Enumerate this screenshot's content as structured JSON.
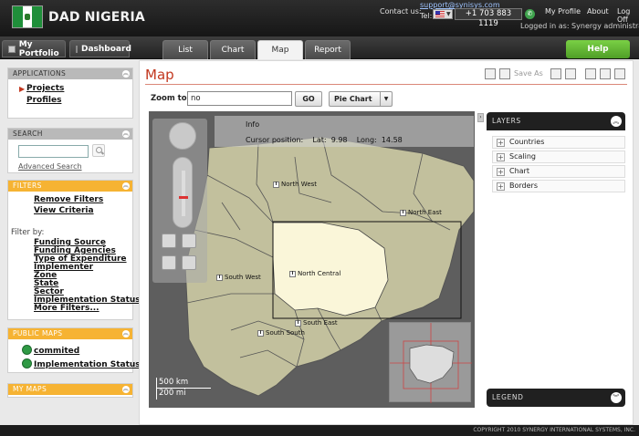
{
  "header": {
    "brand": "DAD NIGERIA",
    "contact_label": "Contact us:",
    "contact_email": "support@synisys.com",
    "tel_label": "Tel:",
    "tel_number": "+1 703 883 1119",
    "links": [
      "My Profile",
      "About",
      "Log Off"
    ],
    "logged_in": "Logged in as:  Synergy  administrator!"
  },
  "tabbar": {
    "my_portfolio": "My Portfolio",
    "dashboard": "Dashboard",
    "tabs": [
      "List",
      "Chart",
      "Map",
      "Report"
    ],
    "active_tab": "Map",
    "help": "Help"
  },
  "sidebar": {
    "applications": {
      "title": "APPLICATIONS",
      "items": [
        "Projects",
        "Profiles"
      ]
    },
    "search": {
      "title": "SEARCH",
      "value": "",
      "advanced": "Advanced Search"
    },
    "filters": {
      "title": "FILTERS",
      "remove": "Remove Filters",
      "view": "View Criteria",
      "filter_by": "Filter by:",
      "items": [
        "Funding Source",
        "Funding Agencies",
        "Type of Expenditure",
        "Implementer",
        "Zone",
        "State",
        "Sector",
        "Implementation Status",
        "More Filters..."
      ]
    },
    "public_maps": {
      "title": "PUBLIC MAPS",
      "items": [
        "commited",
        "Implementation Status"
      ]
    },
    "my_maps": {
      "title": "MY MAPS"
    }
  },
  "main": {
    "title": "Map",
    "save_as": "Save As",
    "zoom_label": "Zoom to:",
    "zoom_value": "no",
    "go": "GO",
    "chart_select": "Pie Chart",
    "info": {
      "title": "Info",
      "cursor_label": "Cursor position:",
      "lat_label": "Lat:",
      "lat": "9.98",
      "long_label": "Long:",
      "long": "14.58"
    },
    "regions": [
      "North West",
      "North East",
      "North Central",
      "South West",
      "South East",
      "South South"
    ],
    "scale": [
      "500 km",
      "200 mi"
    ],
    "layers_title": "LAYERS",
    "layers": [
      "Countries",
      "Scaling",
      "Chart",
      "Borders"
    ],
    "legend_title": "LEGEND"
  },
  "footer": {
    "copyright": "COPYRIGHT 2010 SYNERGY INTERNATIONAL SYSTEMS, INC."
  }
}
